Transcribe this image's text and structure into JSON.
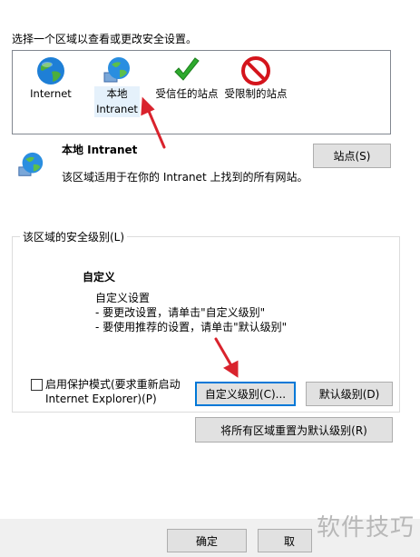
{
  "instruction": "选择一个区域以查看或更改安全设置。",
  "zones": [
    {
      "label": "Internet",
      "icon": "globe-icon"
    },
    {
      "label": "本地 Intranet",
      "icon": "intranet-globe-icon"
    },
    {
      "label": "受信任的站点",
      "icon": "checkmark-icon"
    },
    {
      "label": "受限制的站点",
      "icon": "no-entry-icon"
    }
  ],
  "selected_zone": {
    "title": "本地 Intranet",
    "description": "该区域适用于在你的 Intranet 上找到的所有网站。",
    "sites_button": "站点(S)"
  },
  "security_level": {
    "legend": "该区域的安全级别(L)",
    "level_name": "自定义",
    "lines": [
      "自定义设置",
      "- 要更改设置，请单击\"自定义级别\"",
      "- 要使用推荐的设置，请单击\"默认级别\""
    ],
    "protected_mode_label_1": "启用保护模式(要求重新启动",
    "protected_mode_label_2": "Internet Explorer)(P)",
    "custom_level_button": "自定义级别(C)...",
    "default_level_button": "默认级别(D)",
    "reset_all_button": "将所有区域重置为默认级别(R)"
  },
  "dialog_buttons": {
    "ok": "确定",
    "cancel": "取"
  },
  "watermark": "软件技巧",
  "colors": {
    "arrow": "#d9232d",
    "accent": "#0078d7",
    "check": "#2eaa2e",
    "restricted": "#d4141c"
  }
}
